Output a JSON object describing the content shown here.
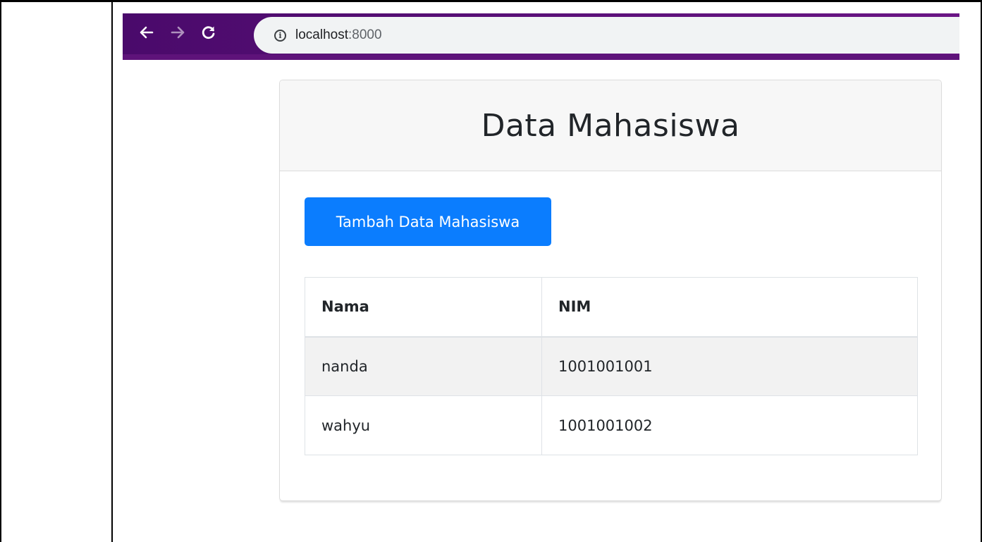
{
  "browser": {
    "url_host": "localhost",
    "url_port": ":8000",
    "back_icon": "arrow-left",
    "forward_icon": "arrow-right",
    "reload_icon": "reload",
    "info_icon": "info-circle",
    "accent_color": "#5e137a"
  },
  "page": {
    "title": "Data Mahasiswa",
    "add_button_label": "Tambah Data Mahasiswa",
    "button_color": "#0b7dfe"
  },
  "table": {
    "headers": [
      "Nama",
      "NIM"
    ],
    "rows": [
      [
        "nanda",
        "1001001001"
      ],
      [
        "wahyu",
        "1001001002"
      ]
    ]
  }
}
